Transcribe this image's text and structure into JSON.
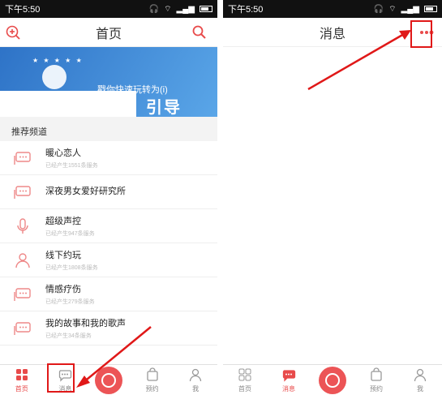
{
  "left": {
    "status": {
      "time": "下午5:50"
    },
    "header": {
      "title": "首页"
    },
    "banner": {
      "caption": "戳你快速玩转为(i)",
      "big_text": "引导"
    },
    "section": {
      "title": "推荐频道"
    },
    "channels": [
      {
        "title": "暖心恋人",
        "subtitle": "已经产生1551条服务",
        "icon": "chat-bubble-icon"
      },
      {
        "title": "深夜男女爱好研究所",
        "subtitle": "",
        "icon": "chat-bubble-icon"
      },
      {
        "title": "超级声控",
        "subtitle": "已经产生947条服务",
        "icon": "microphone-icon"
      },
      {
        "title": "线下约玩",
        "subtitle": "已经产生1808条服务",
        "icon": "person-icon"
      },
      {
        "title": "情感疗伤",
        "subtitle": "已经产生279条服务",
        "icon": "chat-bubble-icon"
      },
      {
        "title": "我的故事和我的歌声",
        "subtitle": "已经产生34条服务",
        "icon": "chat-bubble-icon"
      }
    ],
    "tabs": [
      {
        "label": "首页",
        "icon": "grid-icon",
        "active": true
      },
      {
        "label": "消息",
        "icon": "message-icon",
        "active": false
      },
      {
        "label": "",
        "icon": "record-icon",
        "active": false
      },
      {
        "label": "预约",
        "icon": "bag-icon",
        "active": false
      },
      {
        "label": "我",
        "icon": "user-icon",
        "active": false
      }
    ]
  },
  "right": {
    "status": {
      "time": "下午5:50"
    },
    "header": {
      "title": "消息",
      "more_icon": "more-dots-icon"
    },
    "tabs": [
      {
        "label": "首页",
        "icon": "grid-icon",
        "active": false
      },
      {
        "label": "消息",
        "icon": "message-icon",
        "active": true
      },
      {
        "label": "",
        "icon": "record-icon",
        "active": false
      },
      {
        "label": "预约",
        "icon": "bag-icon",
        "active": false
      },
      {
        "label": "我",
        "icon": "user-icon",
        "active": false
      }
    ]
  },
  "colors": {
    "accent": "#e84a4a",
    "annotation": "#e01818",
    "banner": "#2e73c7"
  }
}
